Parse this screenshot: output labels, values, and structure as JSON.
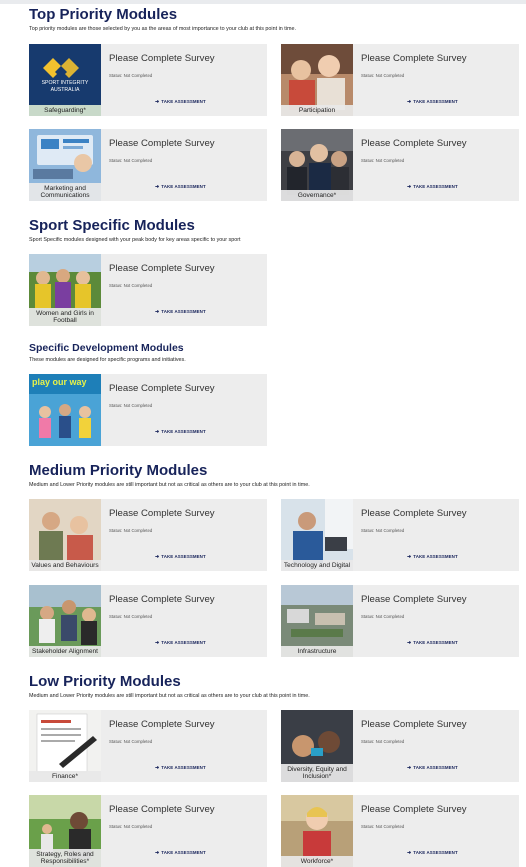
{
  "sections": {
    "top": {
      "title": "Top Priority Modules",
      "desc": "Top priority modules are those selected by you as the areas of most importance to your club at this point in time.",
      "cards": [
        {
          "label": "Safeguarding*",
          "title": "Please Complete Survey",
          "status": "Status: Not Completed",
          "action": "TAKE ASSESSMENT",
          "logo": [
            "SPORT INTEGRITY",
            "AUSTRALIA"
          ]
        },
        {
          "label": "Participation",
          "title": "Please Complete Survey",
          "status": "Status: Not Completed",
          "action": "TAKE ASSESSMENT"
        },
        {
          "label": "Marketing and Communications",
          "title": "Please Complete Survey",
          "status": "Status: Not Completed",
          "action": "TAKE ASSESSMENT"
        },
        {
          "label": "Governance*",
          "title": "Please Complete Survey",
          "status": "Status: Not Completed",
          "action": "TAKE ASSESSMENT"
        }
      ]
    },
    "sport": {
      "title": "Sport Specific Modules",
      "desc": "Sport Specific modules designed with your peak body for key areas specific to your sport",
      "cards": [
        {
          "label": "Women and Girls in Football",
          "title": "Please Complete Survey",
          "status": "Status: Not Completed",
          "action": "TAKE ASSESSMENT"
        }
      ]
    },
    "dev": {
      "title": "Specific Development Modules",
      "desc": "These modules are designed for specific programs and initiatives.",
      "cards": [
        {
          "label": "",
          "title": "Please Complete Survey",
          "status": "Status: Not Completed",
          "action": "TAKE ASSESSMENT",
          "poster": "play our way"
        }
      ]
    },
    "medium": {
      "title": "Medium Priority Modules",
      "desc": "Medium and Lower Priority modules are still important but not as critical as others are to your club at this point in time.",
      "cards": [
        {
          "label": "Values and Behaviours",
          "title": "Please Complete Survey",
          "status": "Status: Not Completed",
          "action": "TAKE ASSESSMENT"
        },
        {
          "label": "Technology and Digital",
          "title": "Please Complete Survey",
          "status": "Status: Not Completed",
          "action": "TAKE ASSESSMENT"
        },
        {
          "label": "Stakeholder Alignment",
          "title": "Please Complete Survey",
          "status": "Status: Not Completed",
          "action": "TAKE ASSESSMENT"
        },
        {
          "label": "Infrastructure",
          "title": "Please Complete Survey",
          "status": "Status: Not Completed",
          "action": "TAKE ASSESSMENT"
        }
      ]
    },
    "low": {
      "title": "Low Priority Modules",
      "desc": "Medium and Lower Priority modules are still important but not as critical as others are to your club at this point in time.",
      "cards": [
        {
          "label": "Finance*",
          "title": "Please Complete Survey",
          "status": "Status: Not Completed",
          "action": "TAKE ASSESSMENT"
        },
        {
          "label": "Diversity, Equity and Inclusion*",
          "title": "Please Complete Survey",
          "status": "Status: Not Completed",
          "action": "TAKE ASSESSMENT"
        },
        {
          "label": "Strategy, Roles and Responsibilities*",
          "title": "Please Complete Survey",
          "status": "Status: Not Completed",
          "action": "TAKE ASSESSMENT"
        },
        {
          "label": "Workforce*",
          "title": "Please Complete Survey",
          "status": "Status: Not Completed",
          "action": "TAKE ASSESSMENT"
        }
      ]
    }
  },
  "icons": {
    "action": "arrow-right-icon"
  },
  "colors": {
    "heading": "#17235a",
    "card_bg": "#ededed",
    "accent": "#2b6fb6"
  }
}
